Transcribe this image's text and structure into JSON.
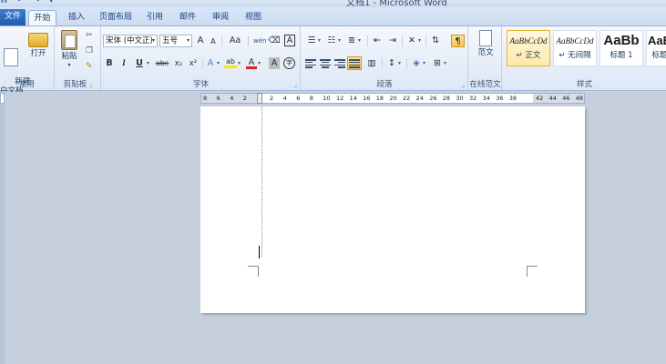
{
  "window": {
    "title": "文档1 - Microsoft Word"
  },
  "tabs": {
    "file": "文件",
    "items": [
      "开始",
      "插入",
      "页面布局",
      "引用",
      "邮件",
      "审阅",
      "视图"
    ],
    "active_index": 0
  },
  "ribbon": {
    "group_common": {
      "label": "常用",
      "new_label": "新建\n白文档",
      "open_label": "打开"
    },
    "group_clipboard": {
      "label": "剪贴板",
      "paste_label": "粘贴"
    },
    "group_font": {
      "label": "字体",
      "font_name": "宋体 (中文正)",
      "font_size": "五号",
      "grow": "A",
      "shrink": "A",
      "aa": "Aa",
      "phonetic": "wén",
      "border": "A",
      "bold": "B",
      "italic": "I",
      "underline": "U",
      "strike": "abc",
      "sub": "x₂",
      "sup": "x²",
      "effect": "A",
      "highlight": "ab",
      "color": "A",
      "shade": "A",
      "enclose": "字"
    },
    "group_paragraph": {
      "label": "段落"
    },
    "group_online": {
      "label": "在线范文",
      "button_label": "范文"
    },
    "group_styles": {
      "label": "样式",
      "tiles": [
        {
          "sample": "AaBbCcDd",
          "name": "↵ 正文",
          "selected": true
        },
        {
          "sample": "AaBbCcDd",
          "name": "↵ 无间隔",
          "selected": false
        },
        {
          "sample": "AaBb",
          "name": "标题 1",
          "selected": false
        },
        {
          "sample": "AaB",
          "name": "标题",
          "selected": false
        }
      ]
    }
  },
  "ruler": {
    "ticks": [
      "8",
      "6",
      "4",
      "2",
      "",
      "2",
      "4",
      "6",
      "8",
      "10",
      "12",
      "14",
      "16",
      "18",
      "20",
      "22",
      "24",
      "26",
      "28",
      "30",
      "32",
      "34",
      "36",
      "38",
      "",
      "42",
      "44",
      "46",
      "48"
    ]
  },
  "colors": {
    "accent": "#1e5bae",
    "highlight_yellow": "#fde596",
    "font_red": "#d6261e"
  }
}
